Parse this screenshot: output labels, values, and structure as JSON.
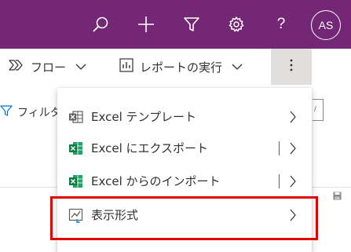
{
  "top_bar": {
    "bg_color": "#742774",
    "icons": [
      "search-icon",
      "plus-icon",
      "filter-icon",
      "gear-icon",
      "help-icon"
    ],
    "help_label": "?",
    "avatar_initials": "AS"
  },
  "command_bar": {
    "flow_label": "フロー",
    "flow_icon": "flow-icon",
    "report_label": "レポートの実行",
    "report_icon": "report-icon",
    "more_icon": "more-vertical-icon"
  },
  "background": {
    "filter_label": "フィルタ",
    "box_glyph": "∕"
  },
  "menu": {
    "items": [
      {
        "label": "Excel テンプレート",
        "icon": "excel-template-icon",
        "has_divider": false
      },
      {
        "label": "Excel にエクスポート",
        "icon": "excel-export-icon",
        "has_divider": true
      },
      {
        "label": "Excel からのインポート",
        "icon": "excel-import-icon",
        "has_divider": true
      },
      {
        "label": "表示形式",
        "icon": "chart-view-icon",
        "has_divider": false
      }
    ]
  },
  "highlight_color": "#e00000"
}
